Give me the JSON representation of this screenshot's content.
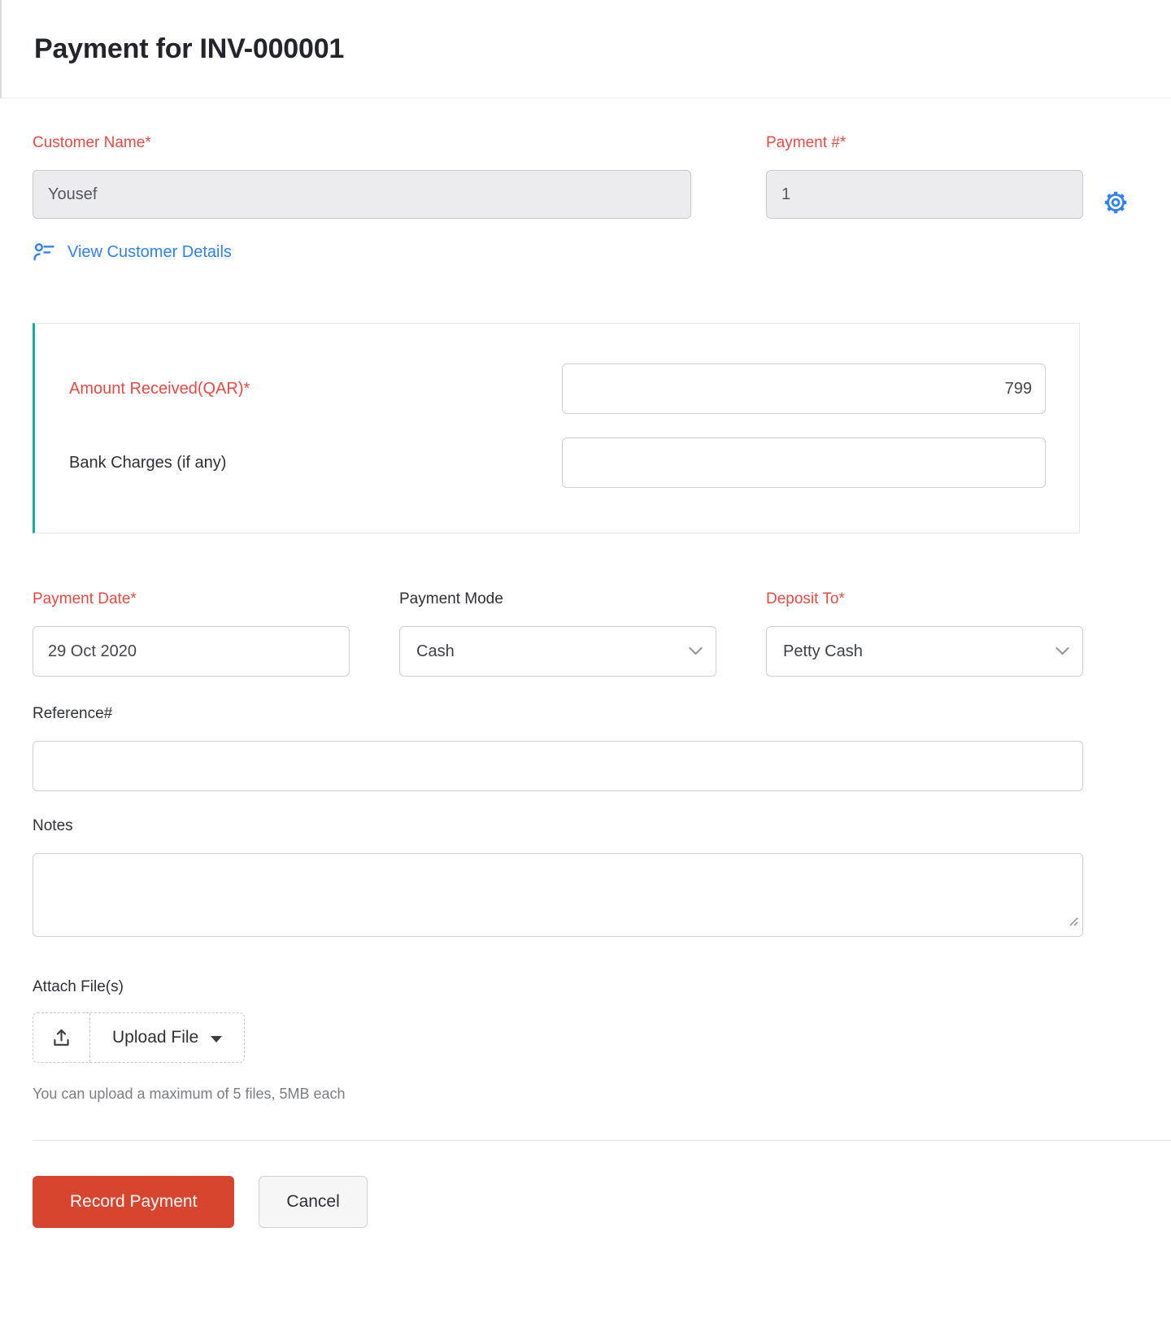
{
  "header": {
    "title": "Payment for INV-000001"
  },
  "form": {
    "customer_name": {
      "label": "Customer Name*",
      "value": "Yousef"
    },
    "payment_number": {
      "label": "Payment #*",
      "value": "1"
    },
    "view_customer_details_label": "View Customer Details",
    "amount_received": {
      "label": "Amount Received(QAR)*",
      "value": "799"
    },
    "bank_charges": {
      "label": "Bank Charges (if any)",
      "value": ""
    },
    "payment_date": {
      "label": "Payment Date*",
      "value": "29 Oct 2020"
    },
    "payment_mode": {
      "label": "Payment Mode",
      "value": "Cash"
    },
    "deposit_to": {
      "label": "Deposit To*",
      "value": "Petty Cash"
    },
    "reference": {
      "label": "Reference#",
      "value": ""
    },
    "notes": {
      "label": "Notes",
      "value": ""
    },
    "attach": {
      "label": "Attach File(s)",
      "button_label": "Upload File",
      "helper": "You can upload a maximum of 5 files, 5MB each"
    }
  },
  "footer": {
    "record_label": "Record Payment",
    "cancel_label": "Cancel"
  },
  "icons": {
    "customer_details": "person-list-icon",
    "settings": "gear-icon",
    "select_arrow": "chevron-down-icon",
    "upload": "upload-tray-icon",
    "upload_menu": "caret-down-icon",
    "notes_resize": "resize-handle-icon"
  },
  "colors": {
    "required_label": "#e24c45",
    "accent_blue": "#3080ef",
    "accent_teal": "#10af9e",
    "primary_button": "#d8452f",
    "disabled_input_bg": "#ececee"
  }
}
